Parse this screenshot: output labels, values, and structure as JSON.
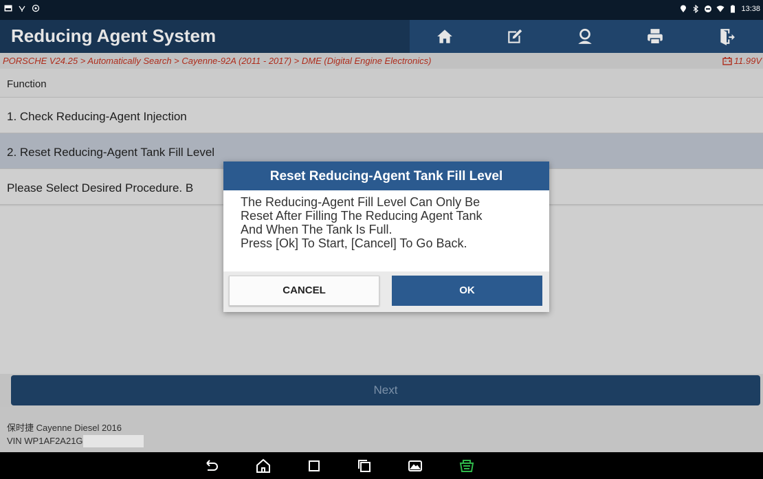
{
  "status_bar": {
    "time": "13:38",
    "left_icons": [
      "image-notification-icon",
      "usb-icon",
      "settings-gear-icon"
    ],
    "right_icons": [
      "location-icon",
      "bluetooth-icon",
      "do-not-disturb-icon",
      "wifi-icon",
      "battery-icon"
    ]
  },
  "header": {
    "title": "Reducing Agent System",
    "toolbar": [
      "home-icon",
      "report-edit-icon",
      "person-icon",
      "print-icon",
      "exit-icon"
    ]
  },
  "breadcrumb": {
    "path": "PORSCHE V24.25 > Automatically Search > Cayenne-92A (2011 - 2017) > DME (Digital Engine Electronics)",
    "voltage": "11.99V"
  },
  "list": {
    "header": "Function",
    "items": [
      "1. Check Reducing-Agent Injection",
      "2. Reset Reducing-Agent Tank Fill Level"
    ],
    "prompt": "Please Select Desired Procedure.  B"
  },
  "next_label": "Next",
  "footer": {
    "vehicle": "保时捷 Cayenne Diesel 2016",
    "vin": "VIN WP1AF2A21G"
  },
  "dialog": {
    "title": "Reset Reducing-Agent Tank Fill Level",
    "lines": [
      "The Reducing-Agent Fill Level Can Only Be",
      "Reset After Filling The Reducing Agent Tank",
      "And When The Tank Is Full.",
      "Press [Ok] To Start, [Cancel] To Go Back."
    ],
    "cancel_label": "CANCEL",
    "ok_label": "OK"
  },
  "nav_bar": [
    "back-icon",
    "home-icon",
    "recents-icon",
    "multiwindow-icon",
    "screenshot-icon",
    "vci-connector-icon"
  ],
  "colors": {
    "header_bg": "#1b3a5c",
    "toolbar_button": "#244c78",
    "accent_blue": "#2b5a8f",
    "breadcrumb_text": "#c2311f",
    "connector_green": "#2fb84a"
  }
}
